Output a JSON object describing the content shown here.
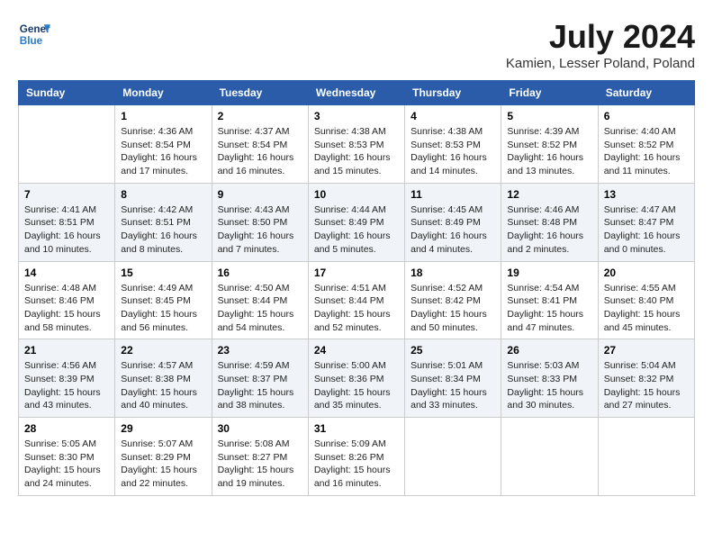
{
  "header": {
    "logo_general": "General",
    "logo_blue": "Blue",
    "month_year": "July 2024",
    "location": "Kamien, Lesser Poland, Poland"
  },
  "weekdays": [
    "Sunday",
    "Monday",
    "Tuesday",
    "Wednesday",
    "Thursday",
    "Friday",
    "Saturday"
  ],
  "weeks": [
    [
      {
        "day": "",
        "info": ""
      },
      {
        "day": "1",
        "info": "Sunrise: 4:36 AM\nSunset: 8:54 PM\nDaylight: 16 hours\nand 17 minutes."
      },
      {
        "day": "2",
        "info": "Sunrise: 4:37 AM\nSunset: 8:54 PM\nDaylight: 16 hours\nand 16 minutes."
      },
      {
        "day": "3",
        "info": "Sunrise: 4:38 AM\nSunset: 8:53 PM\nDaylight: 16 hours\nand 15 minutes."
      },
      {
        "day": "4",
        "info": "Sunrise: 4:38 AM\nSunset: 8:53 PM\nDaylight: 16 hours\nand 14 minutes."
      },
      {
        "day": "5",
        "info": "Sunrise: 4:39 AM\nSunset: 8:52 PM\nDaylight: 16 hours\nand 13 minutes."
      },
      {
        "day": "6",
        "info": "Sunrise: 4:40 AM\nSunset: 8:52 PM\nDaylight: 16 hours\nand 11 minutes."
      }
    ],
    [
      {
        "day": "7",
        "info": "Sunrise: 4:41 AM\nSunset: 8:51 PM\nDaylight: 16 hours\nand 10 minutes."
      },
      {
        "day": "8",
        "info": "Sunrise: 4:42 AM\nSunset: 8:51 PM\nDaylight: 16 hours\nand 8 minutes."
      },
      {
        "day": "9",
        "info": "Sunrise: 4:43 AM\nSunset: 8:50 PM\nDaylight: 16 hours\nand 7 minutes."
      },
      {
        "day": "10",
        "info": "Sunrise: 4:44 AM\nSunset: 8:49 PM\nDaylight: 16 hours\nand 5 minutes."
      },
      {
        "day": "11",
        "info": "Sunrise: 4:45 AM\nSunset: 8:49 PM\nDaylight: 16 hours\nand 4 minutes."
      },
      {
        "day": "12",
        "info": "Sunrise: 4:46 AM\nSunset: 8:48 PM\nDaylight: 16 hours\nand 2 minutes."
      },
      {
        "day": "13",
        "info": "Sunrise: 4:47 AM\nSunset: 8:47 PM\nDaylight: 16 hours\nand 0 minutes."
      }
    ],
    [
      {
        "day": "14",
        "info": "Sunrise: 4:48 AM\nSunset: 8:46 PM\nDaylight: 15 hours\nand 58 minutes."
      },
      {
        "day": "15",
        "info": "Sunrise: 4:49 AM\nSunset: 8:45 PM\nDaylight: 15 hours\nand 56 minutes."
      },
      {
        "day": "16",
        "info": "Sunrise: 4:50 AM\nSunset: 8:44 PM\nDaylight: 15 hours\nand 54 minutes."
      },
      {
        "day": "17",
        "info": "Sunrise: 4:51 AM\nSunset: 8:44 PM\nDaylight: 15 hours\nand 52 minutes."
      },
      {
        "day": "18",
        "info": "Sunrise: 4:52 AM\nSunset: 8:42 PM\nDaylight: 15 hours\nand 50 minutes."
      },
      {
        "day": "19",
        "info": "Sunrise: 4:54 AM\nSunset: 8:41 PM\nDaylight: 15 hours\nand 47 minutes."
      },
      {
        "day": "20",
        "info": "Sunrise: 4:55 AM\nSunset: 8:40 PM\nDaylight: 15 hours\nand 45 minutes."
      }
    ],
    [
      {
        "day": "21",
        "info": "Sunrise: 4:56 AM\nSunset: 8:39 PM\nDaylight: 15 hours\nand 43 minutes."
      },
      {
        "day": "22",
        "info": "Sunrise: 4:57 AM\nSunset: 8:38 PM\nDaylight: 15 hours\nand 40 minutes."
      },
      {
        "day": "23",
        "info": "Sunrise: 4:59 AM\nSunset: 8:37 PM\nDaylight: 15 hours\nand 38 minutes."
      },
      {
        "day": "24",
        "info": "Sunrise: 5:00 AM\nSunset: 8:36 PM\nDaylight: 15 hours\nand 35 minutes."
      },
      {
        "day": "25",
        "info": "Sunrise: 5:01 AM\nSunset: 8:34 PM\nDaylight: 15 hours\nand 33 minutes."
      },
      {
        "day": "26",
        "info": "Sunrise: 5:03 AM\nSunset: 8:33 PM\nDaylight: 15 hours\nand 30 minutes."
      },
      {
        "day": "27",
        "info": "Sunrise: 5:04 AM\nSunset: 8:32 PM\nDaylight: 15 hours\nand 27 minutes."
      }
    ],
    [
      {
        "day": "28",
        "info": "Sunrise: 5:05 AM\nSunset: 8:30 PM\nDaylight: 15 hours\nand 24 minutes."
      },
      {
        "day": "29",
        "info": "Sunrise: 5:07 AM\nSunset: 8:29 PM\nDaylight: 15 hours\nand 22 minutes."
      },
      {
        "day": "30",
        "info": "Sunrise: 5:08 AM\nSunset: 8:27 PM\nDaylight: 15 hours\nand 19 minutes."
      },
      {
        "day": "31",
        "info": "Sunrise: 5:09 AM\nSunset: 8:26 PM\nDaylight: 15 hours\nand 16 minutes."
      },
      {
        "day": "",
        "info": ""
      },
      {
        "day": "",
        "info": ""
      },
      {
        "day": "",
        "info": ""
      }
    ]
  ]
}
